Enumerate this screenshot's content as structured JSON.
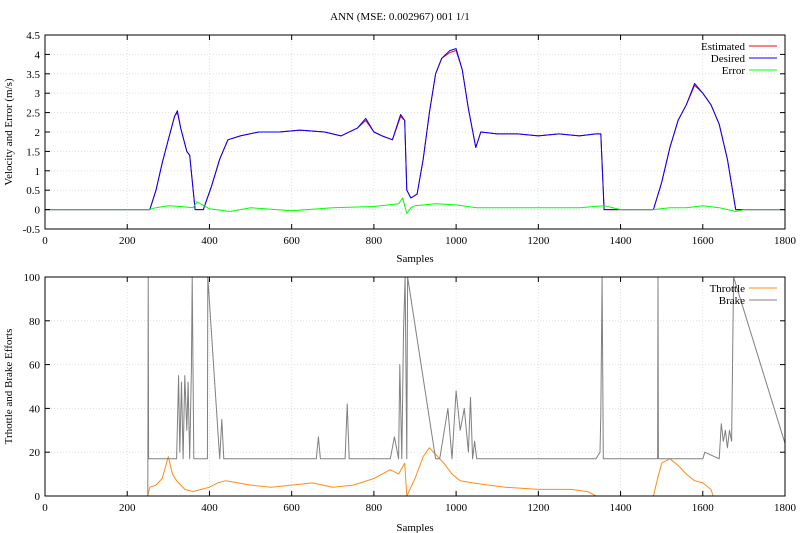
{
  "title": "ANN (MSE: 0.002967) 001 1/1",
  "chart_data": [
    {
      "type": "line",
      "xlabel": "Samples",
      "ylabel": "Velocity and Error (m/s)",
      "xlim": [
        0,
        1800
      ],
      "ylim": [
        -0.5,
        4.5
      ],
      "xticks": [
        0,
        200,
        400,
        600,
        800,
        1000,
        1200,
        1400,
        1600,
        1800
      ],
      "yticks": [
        -0.5,
        0,
        0.5,
        1,
        1.5,
        2,
        2.5,
        3,
        3.5,
        4,
        4.5
      ],
      "grid": true,
      "legend_position": "top-right",
      "series": [
        {
          "name": "Estimated",
          "color": "#ff0000",
          "x": [
            0,
            255,
            270,
            285,
            300,
            315,
            322,
            330,
            345,
            352,
            365,
            385,
            405,
            425,
            445,
            475,
            520,
            570,
            620,
            680,
            720,
            760,
            780,
            800,
            820,
            845,
            865,
            875,
            880,
            890,
            905,
            920,
            935,
            950,
            965,
            985,
            1000,
            1015,
            1030,
            1048,
            1060,
            1100,
            1150,
            1200,
            1250,
            1300,
            1340,
            1352,
            1360,
            1480,
            1500,
            1520,
            1540,
            1560,
            1580,
            1600,
            1620,
            1640,
            1660,
            1680,
            1800
          ],
          "y": [
            0,
            0,
            0.5,
            1.2,
            1.8,
            2.4,
            2.5,
            2.1,
            1.5,
            1.4,
            0,
            0,
            0.6,
            1.3,
            1.8,
            1.9,
            2.0,
            2.0,
            2.05,
            2.0,
            1.9,
            2.1,
            2.3,
            2.0,
            1.9,
            1.8,
            2.4,
            2.3,
            0.5,
            0.3,
            0.4,
            1.3,
            2.5,
            3.5,
            3.9,
            4.05,
            4.1,
            3.6,
            2.6,
            1.6,
            2.0,
            1.95,
            1.95,
            1.9,
            1.95,
            1.9,
            1.95,
            1.95,
            0,
            0,
            0.7,
            1.6,
            2.3,
            2.7,
            3.2,
            3.0,
            2.7,
            2.2,
            1.3,
            0,
            0
          ]
        },
        {
          "name": "Desired",
          "color": "#0000ff",
          "x": [
            0,
            255,
            270,
            285,
            300,
            315,
            322,
            330,
            345,
            352,
            365,
            385,
            405,
            425,
            445,
            475,
            520,
            570,
            620,
            680,
            720,
            760,
            780,
            800,
            820,
            845,
            865,
            875,
            880,
            890,
            905,
            920,
            935,
            950,
            965,
            985,
            1000,
            1015,
            1030,
            1048,
            1060,
            1100,
            1150,
            1200,
            1250,
            1300,
            1340,
            1352,
            1360,
            1480,
            1500,
            1520,
            1540,
            1560,
            1580,
            1600,
            1620,
            1640,
            1660,
            1680,
            1800
          ],
          "y": [
            0,
            0,
            0.5,
            1.2,
            1.8,
            2.4,
            2.55,
            2.1,
            1.5,
            1.4,
            0,
            0,
            0.6,
            1.3,
            1.8,
            1.9,
            2.0,
            2.0,
            2.05,
            2.0,
            1.9,
            2.1,
            2.35,
            2.0,
            1.9,
            1.8,
            2.45,
            2.3,
            0.5,
            0.3,
            0.4,
            1.3,
            2.5,
            3.5,
            3.9,
            4.1,
            4.15,
            3.6,
            2.6,
            1.6,
            2.0,
            1.95,
            1.95,
            1.9,
            1.95,
            1.9,
            1.95,
            1.95,
            0,
            0,
            0.7,
            1.6,
            2.3,
            2.7,
            3.25,
            3.0,
            2.7,
            2.2,
            1.3,
            0,
            0
          ]
        },
        {
          "name": "Error",
          "color": "#00ff00",
          "x": [
            0,
            250,
            270,
            300,
            330,
            360,
            370,
            400,
            450,
            500,
            600,
            700,
            800,
            860,
            870,
            880,
            890,
            900,
            950,
            1000,
            1050,
            1100,
            1200,
            1300,
            1360,
            1400,
            1480,
            1520,
            1560,
            1600,
            1640,
            1680,
            1700,
            1800
          ],
          "y": [
            0,
            0,
            0.05,
            0.1,
            0.08,
            0.05,
            0.2,
            0.02,
            -0.05,
            0.05,
            -0.03,
            0.05,
            0.08,
            0.15,
            0.3,
            -0.1,
            0.05,
            0.1,
            0.15,
            0.12,
            0.05,
            0.05,
            0.05,
            0.05,
            0.1,
            0,
            0,
            0.05,
            0.05,
            0.1,
            0.05,
            -0.05,
            0,
            0
          ]
        }
      ]
    },
    {
      "type": "line",
      "xlabel": "Samples",
      "ylabel": "Trhottle and Brake Efforts",
      "xlim": [
        0,
        1800
      ],
      "ylim": [
        0,
        100
      ],
      "xticks": [
        0,
        200,
        400,
        600,
        800,
        1000,
        1200,
        1400,
        1600,
        1800
      ],
      "yticks": [
        0,
        20,
        40,
        60,
        80,
        100
      ],
      "grid": true,
      "legend_position": "top-right",
      "series": [
        {
          "name": "Throttle",
          "color": "#ff8c1a",
          "x": [
            0,
            250,
            255,
            270,
            285,
            300,
            310,
            320,
            340,
            360,
            380,
            400,
            420,
            440,
            470,
            500,
            550,
            600,
            650,
            700,
            750,
            800,
            840,
            860,
            875,
            880,
            900,
            920,
            935,
            950,
            970,
            990,
            1010,
            1040,
            1080,
            1120,
            1200,
            1280,
            1320,
            1340,
            1480,
            1490,
            1500,
            1520,
            1540,
            1560,
            1580,
            1600,
            1620,
            1625,
            1800
          ],
          "y": [
            0,
            0,
            4,
            5,
            8,
            18,
            10,
            7,
            3,
            2,
            3,
            4,
            6,
            7,
            6,
            5,
            4,
            5,
            6,
            4,
            5,
            8,
            12,
            10,
            15,
            0,
            8,
            18,
            22,
            19,
            15,
            10,
            7,
            6,
            5,
            4,
            3,
            3,
            2,
            0,
            0,
            8,
            15,
            17,
            14,
            10,
            7,
            6,
            3,
            0,
            0
          ]
        },
        {
          "name": "Brake",
          "color": "#808080",
          "x": [
            0,
            250,
            251,
            252,
            320,
            325,
            328,
            332,
            336,
            340,
            345,
            348,
            352,
            356,
            358,
            362,
            365,
            395,
            396,
            425,
            430,
            435,
            660,
            665,
            670,
            690,
            730,
            735,
            740,
            800,
            840,
            850,
            860,
            863,
            868,
            872,
            876,
            880,
            882,
            950,
            960,
            980,
            990,
            1000,
            1010,
            1020,
            1030,
            1035,
            1040,
            1045,
            1050,
            1340,
            1350,
            1352,
            1355,
            1358,
            1490,
            1491,
            1492,
            1600,
            1605,
            1640,
            1645,
            1650,
            1655,
            1660,
            1665,
            1670,
            1675,
            1800
          ],
          "y": [
            0,
            0,
            100,
            17,
            17,
            55,
            20,
            52,
            17,
            55,
            30,
            52,
            17,
            58,
            100,
            17,
            17,
            17,
            100,
            17,
            35,
            17,
            17,
            27,
            17,
            17,
            17,
            42,
            17,
            17,
            17,
            27,
            17,
            60,
            17,
            75,
            100,
            17,
            100,
            17,
            17,
            40,
            17,
            48,
            30,
            40,
            20,
            45,
            17,
            25,
            17,
            17,
            20,
            37,
            100,
            17,
            17,
            100,
            17,
            17,
            20,
            17,
            33,
            25,
            30,
            22,
            30,
            25,
            100,
            24
          ]
        }
      ]
    }
  ]
}
